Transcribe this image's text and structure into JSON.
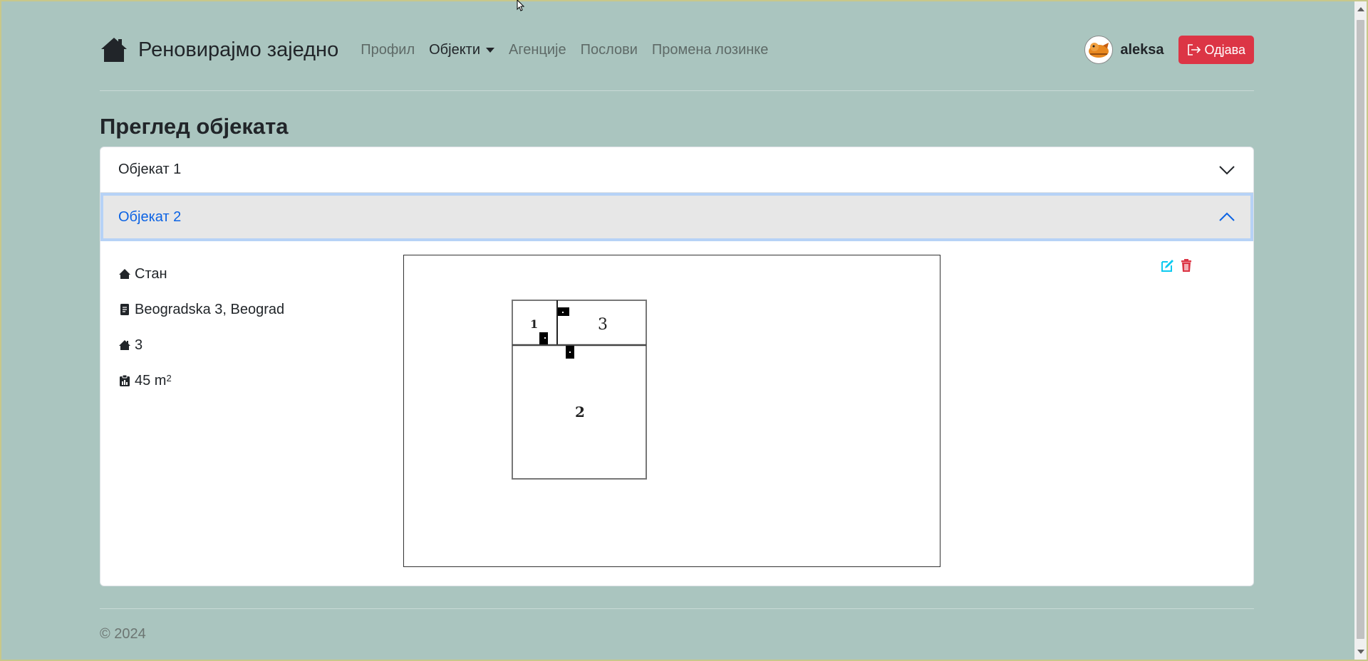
{
  "navbar": {
    "brand": "Реновирајмо заједно",
    "links": [
      "Профил",
      "Објекти",
      "Агенције",
      "Послови",
      "Промена лозинке"
    ],
    "username": "aleksa",
    "logout_label": "Одјава"
  },
  "page_title": "Преглед објеката",
  "accordion": {
    "items": [
      {
        "label": "Објекат 1",
        "expanded": false
      },
      {
        "label": "Објекат 2",
        "expanded": true
      }
    ],
    "details": {
      "type": "Стан",
      "address": "Beogradska 3, Beograd",
      "rooms": "3",
      "area_value": "45 m",
      "area_unit_sup": "2"
    },
    "sketch_rooms": [
      "1",
      "2",
      "3"
    ]
  },
  "footer": {
    "text": "© 2024"
  },
  "colors": {
    "background": "#aac5bf",
    "accent_blue": "#0c63e4",
    "danger": "#dc3545",
    "edit_icon": "#0dcaf0"
  },
  "icons": {
    "brand": "house-icon",
    "type": "house-icon",
    "address": "document-icon",
    "rooms": "house-icon",
    "area": "clipboard-icon",
    "edit": "pencil-square-icon",
    "delete": "trash-icon",
    "logout": "box-arrow-right-icon"
  }
}
